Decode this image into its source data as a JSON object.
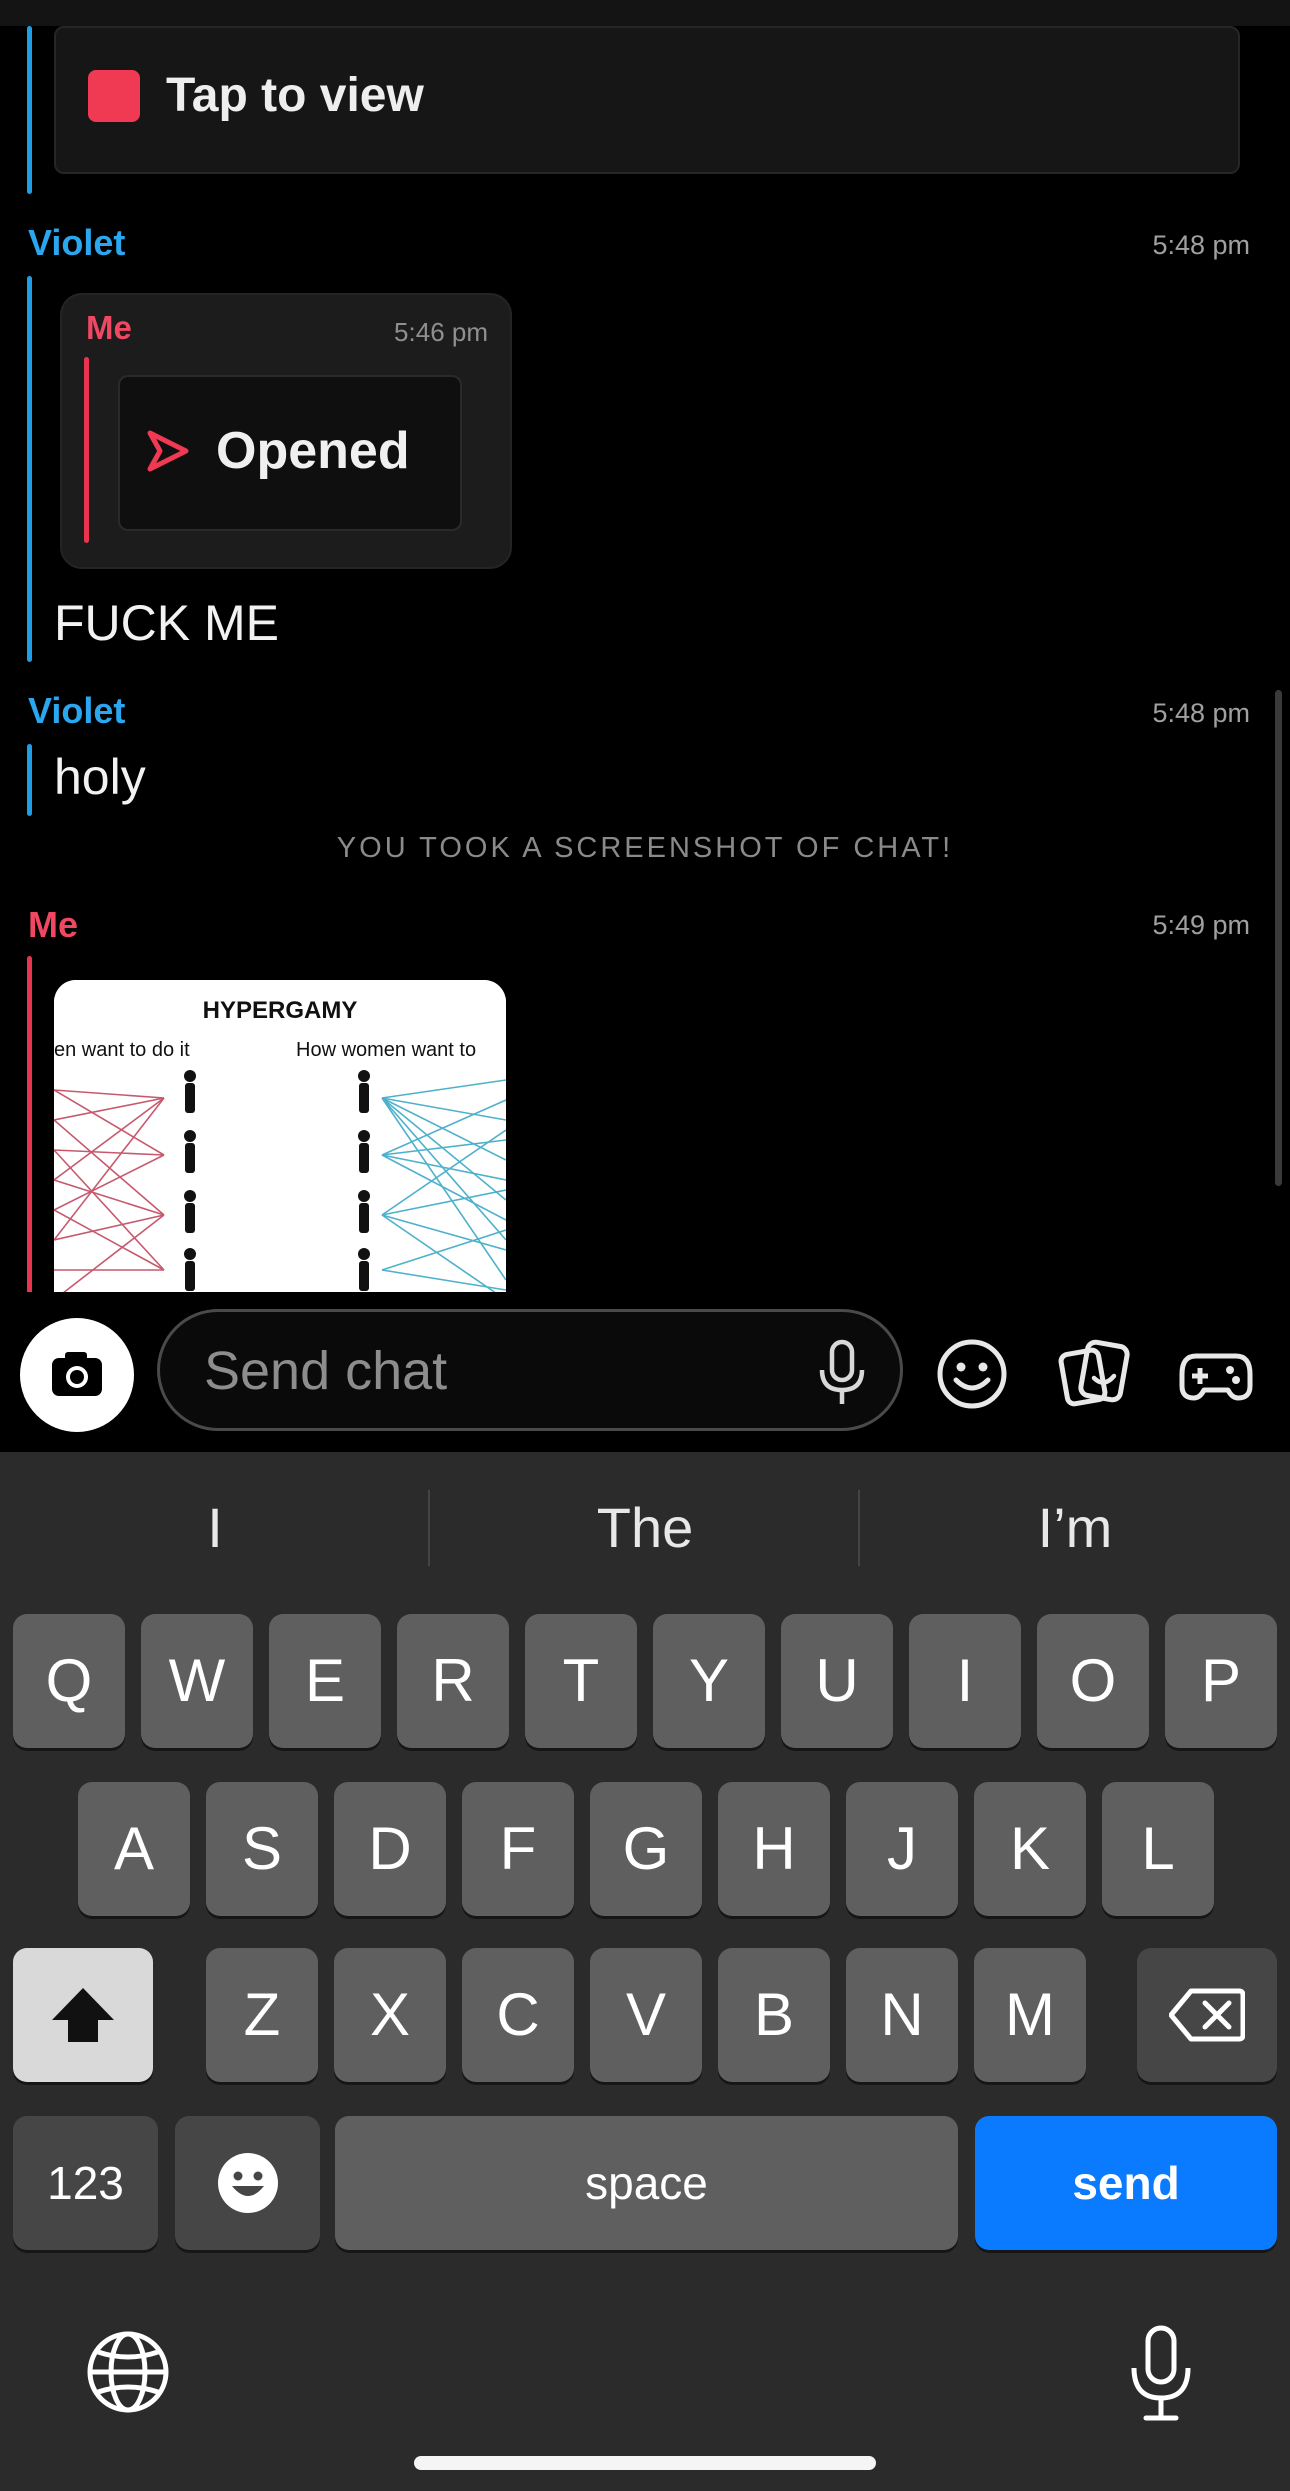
{
  "chat": {
    "snap": {
      "label": "Tap to view",
      "color": "#f03a53"
    },
    "messages": [
      {
        "sender": "Violet",
        "time": "5:48 pm",
        "quote": {
          "sender": "Me",
          "time": "5:46 pm",
          "label": "Opened"
        },
        "text": "FUCK ME"
      },
      {
        "sender": "Violet",
        "time": "5:48 pm",
        "text": "holy"
      },
      {
        "sender": "Me",
        "time": "5:49 pm",
        "image": {
          "title": "HYPERGAMY",
          "left_caption": "en want to do it",
          "right_caption": "How women want to"
        }
      }
    ],
    "system_note": "YOU TOOK A SCREENSHOT OF CHAT!"
  },
  "input_bar": {
    "placeholder": "Send chat",
    "icons": [
      "camera-icon",
      "microphone-icon",
      "emoji-icon",
      "stickers-icon",
      "games-icon"
    ]
  },
  "keyboard": {
    "suggestions": [
      "I",
      "The",
      "I’m"
    ],
    "row1": [
      "Q",
      "W",
      "E",
      "R",
      "T",
      "Y",
      "U",
      "I",
      "O",
      "P"
    ],
    "row2": [
      "A",
      "S",
      "D",
      "F",
      "G",
      "H",
      "J",
      "K",
      "L"
    ],
    "row3": [
      "Z",
      "X",
      "C",
      "V",
      "B",
      "N",
      "M"
    ],
    "numbers_label": "123",
    "space_label": "space",
    "send_label": "send",
    "icons": [
      "shift-icon",
      "backspace-icon",
      "emoji-icon",
      "globe-icon",
      "dictation-icon"
    ]
  },
  "colors": {
    "accent_blue": "#1f9ee6",
    "accent_red": "#e8344f",
    "send_key": "#0a7aff"
  }
}
